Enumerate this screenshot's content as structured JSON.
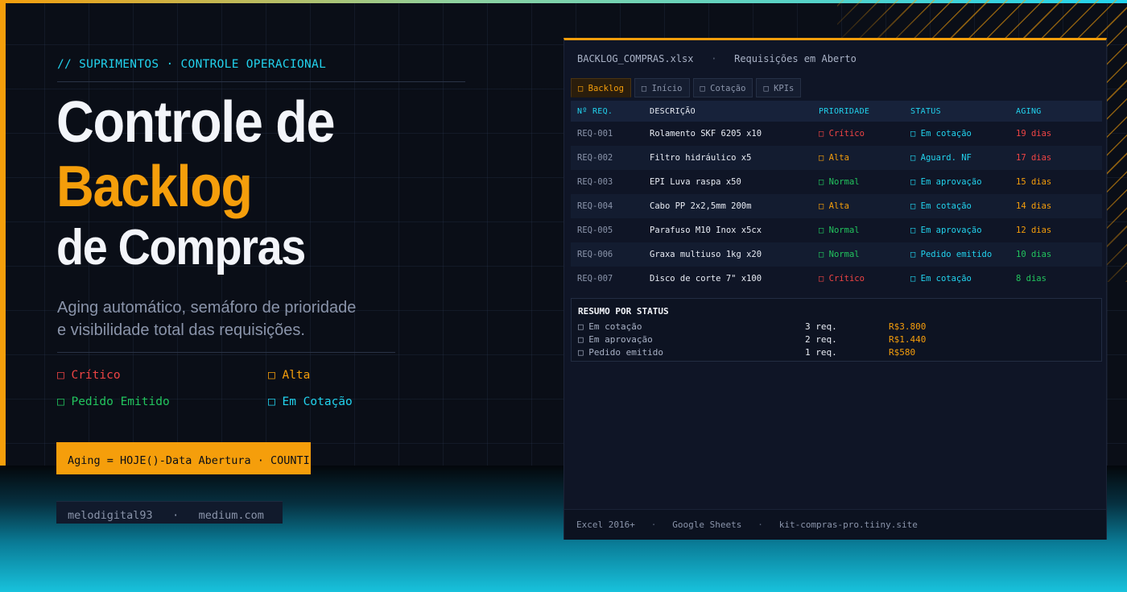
{
  "hero": {
    "eyebrow": "// SUPRIMENTOS · CONTROLE OPERACIONAL",
    "title_line1": "Controle de",
    "title_line2": "Backlog",
    "title_line3": "de Compras",
    "subtitle_line1": "Aging automático, semáforo de prioridade",
    "subtitle_line2": "e visibilidade total das requisições.",
    "legend": [
      {
        "icon": "□",
        "label": "Crítico",
        "color": "#ef4444"
      },
      {
        "icon": "□",
        "label": "Alta",
        "color": "#f59e0b"
      },
      {
        "icon": "□",
        "label": "Pedido Emitido",
        "color": "#22c55e"
      },
      {
        "icon": "□",
        "label": "Em Cotação",
        "color": "#22d3ee"
      }
    ],
    "formula": "Aging = HOJE()-Data Abertura · COUNTIF",
    "credit_author": "melodigital93",
    "credit_sep": "·",
    "credit_site": "medium.com"
  },
  "panel": {
    "filename": "BACKLOG_COMPRAS.xlsx",
    "header_sep": "·",
    "sheet_title": "Requisições em Aberto",
    "tabs": [
      {
        "icon": "□",
        "label": "Backlog"
      },
      {
        "icon": "□",
        "label": "Início"
      },
      {
        "icon": "□",
        "label": "Cotação"
      },
      {
        "icon": "□",
        "label": "KPIs"
      }
    ],
    "columns": [
      "Nº REQ.",
      "DESCRIÇÃO",
      "PRIORIDADE",
      "STATUS",
      "AGING"
    ],
    "rows": [
      {
        "id": "REQ-001",
        "desc": "Rolamento SKF 6205 x10",
        "prio_icon": "□",
        "prio": "Crítico",
        "status_icon": "□",
        "status": "Em cotação",
        "aging": "19 dias"
      },
      {
        "id": "REQ-002",
        "desc": "Filtro hidráulico x5",
        "prio_icon": "□",
        "prio": "Alta",
        "status_icon": "□",
        "status": "Aguard. NF",
        "aging": "17 dias"
      },
      {
        "id": "REQ-003",
        "desc": "EPI Luva raspa x50",
        "prio_icon": "□",
        "prio": "Normal",
        "status_icon": "□",
        "status": "Em aprovação",
        "aging": "15 dias"
      },
      {
        "id": "REQ-004",
        "desc": "Cabo PP 2x2,5mm 200m",
        "prio_icon": "□",
        "prio": "Alta",
        "status_icon": "□",
        "status": "Em cotação",
        "aging": "14 dias"
      },
      {
        "id": "REQ-005",
        "desc": "Parafuso M10 Inox x5cx",
        "prio_icon": "□",
        "prio": "Normal",
        "status_icon": "□",
        "status": "Em aprovação",
        "aging": "12 dias"
      },
      {
        "id": "REQ-006",
        "desc": "Graxa multiuso 1kg x20",
        "prio_icon": "□",
        "prio": "Normal",
        "status_icon": "□",
        "status": "Pedido emitido",
        "aging": "10 dias"
      },
      {
        "id": "REQ-007",
        "desc": "Disco de corte 7\" x100",
        "prio_icon": "□",
        "prio": "Crítico",
        "status_icon": "□",
        "status": "Em cotação",
        "aging": "8 dias"
      }
    ],
    "summary_title": "RESUMO POR STATUS",
    "summary": [
      {
        "icon": "□",
        "label": "Em cotação",
        "count": "3 req.",
        "value": "R$3.800"
      },
      {
        "icon": "□",
        "label": "Em aprovação",
        "count": "2 req.",
        "value": "R$1.440"
      },
      {
        "icon": "□",
        "label": "Pedido emitido",
        "count": "1 req.",
        "value": "R$580"
      }
    ],
    "footer": {
      "item1": "Excel 2016+",
      "item2": "Google Sheets",
      "item3": "kit-compras-pro.tiiny.site",
      "sep": "·"
    }
  },
  "colors": {
    "accent": "#f59e0b",
    "cyan": "#22d3ee",
    "critical": "#ef4444",
    "normal": "#22c55e"
  }
}
